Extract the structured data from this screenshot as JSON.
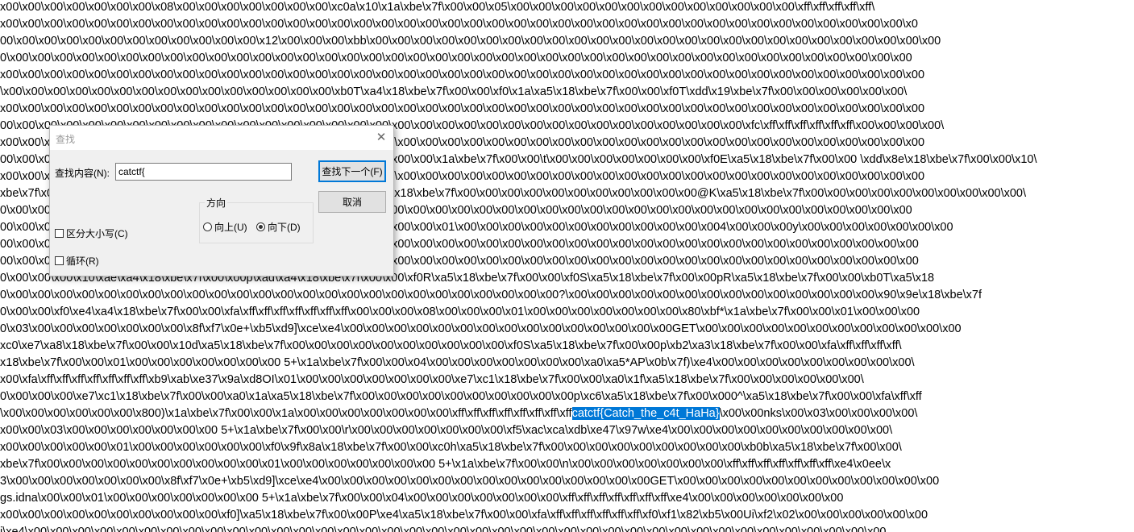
{
  "editor": {
    "lines": [
      {
        "text": "x00\\x00\\x00\\x00\\x00\\x00\\x00\\x08\\x00\\x00\\x00\\x00\\x00\\x00\\x00\\xc0a\\x10\\x1a\\xbe\\x7f\\x00\\x00\\x05\\x00\\x00\\x00\\x00\\x00\\x00\\x00\\x00\\x00\\x00\\x00\\x00\\x00\\xff\\xff\\xff\\xff\\xff\\"
      },
      {
        "text": "x00\\x00\\x00\\x00\\x00\\x00\\x00\\x00\\x00\\x00\\x00\\x00\\x00\\x00\\x00\\x00\\x00\\x00\\x00\\x00\\x00\\x00\\x00\\x00\\x00\\x00\\x00\\x00\\x00\\x00\\x00\\x00\\x00\\x00\\x00\\x00\\x00\\x00\\x00\\x00\\x00\\x0"
      },
      {
        "text": "00\\x00\\x00\\x00\\x00\\x00\\x00\\x00\\x00\\x00\\x00\\x00\\x12\\x00\\x00\\x00\\xbb\\x00\\x00\\x00\\x00\\x00\\x00\\x00\\x00\\x00\\x00\\x00\\x00\\x00\\x00\\x00\\x00\\x00\\x00\\x00\\x00\\x00\\x00\\x00\\x00\\x00\\x00"
      },
      {
        "text": "0\\x00\\x00\\x00\\x00\\x00\\x00\\x00\\x00\\x00\\x00\\x00\\x00\\x00\\x00\\x00\\x00\\x00\\x00\\x00\\x00\\x00\\x00\\x00\\x00\\x00\\x00\\x00\\x00\\x00\\x00\\x00\\x00\\x00\\x00\\x00\\x00\\x00\\x00\\x00\\x00\\x00"
      },
      {
        "text": "x00\\x00\\x00\\x00\\x00\\x00\\x00\\x00\\x00\\x00\\x00\\x00\\x00\\x00\\x00\\x00\\x00\\x00\\x00\\x00\\x00\\x00\\x00\\x00\\x00\\x00\\x00\\x00\\x00\\x00\\x00\\x00\\x00\\x00\\x00\\x00\\x00\\x00\\x00\\x00\\x00\\x00"
      },
      {
        "text": "\\x00\\x00\\x00\\x00\\x00\\x00\\x00\\x00\\x00\\x00\\x00\\x00\\x00\\x00\\x00\\xb0T\\xa4\\x18\\xbe\\x7f\\x00\\x00\\xf0\\x1a\\xa5\\x18\\xbe\\x7f\\x00\\x00\\xf0T\\xdd\\x19\\xbe\\x7f\\x00\\x00\\x00\\x00\\x00\\x00\\"
      },
      {
        "text": "x00\\x00\\x00\\x00\\x00\\x00\\x00\\x00\\x00\\x00\\x00\\x00\\x00\\x00\\x00\\x00\\x00\\x00\\x00\\x00\\x00\\x00\\x00\\x00\\x00\\x00\\x00\\x00\\x00\\x00\\x00\\x00\\x00\\x00\\x00\\x00\\x00\\x00\\x00\\x00\\x00\\x00"
      },
      {
        "text": "00\\x00\\x00\\x00\\x00\\x00\\x00\\x00\\x00\\x00\\x00\\x00\\x00\\x00\\x00\\x00\\x00\\x00\\x00\\x00\\x00\\x00\\x00\\x00\\x00\\x00\\x00\\x00\\x00\\x00\\x00\\x00\\x00\\x00\\xfc\\xff\\xff\\xff\\xff\\xff\\xff\\x00\\x00\\x00\\x00\\"
      },
      {
        "text": "x00\\x00\\x00\\x00\\x00\\x00\\x00\\x00\\x00\\x00\\x00\\x00\\x00\\x00\\x00\\x00\\x00\\x00\\x00\\x00\\x00\\x00\\x00\\x00\\x00\\x00\\x00\\x00\\x00\\x00\\x00\\x00\\x00\\x00\\x00\\x00\\x00\\x00\\x00\\x00\\x00\\x00"
      },
      {
        "text": "00\\x00\\x00\\x00\\x00\\x00\\x00\\x00\\x00\\x00\\x00\\x00\\x00\\x00\\x00\\x00\\x00\\x00\\x00\\x00\\x1a\\xbe\\x7f\\x00\\x00\\t\\x00\\x00\\x00\\x00\\x00\\x00\\x00\\xf0E\\xa5\\x18\\xbe\\x7f\\x00\\x00 \\xdd\\x8e\\x18\\xbe\\x7f\\x00\\x00\\x10\\"
      },
      {
        "text": "x00\\x00\\x00\\x00\\x00\\x00\\x00\\x00\\x00\\x00\\x00\\x00\\x00\\x00\\x00\\x00\\x00\\x00\\x00\\x00\\x00\\x00\\x00\\x00\\x00\\x00\\x00\\x00\\x00\\x00\\x00\\x00\\x00\\x00\\x00\\x00\\x00\\x00\\x00\\x00\\x00\\x00"
      },
      {
        "text": "xbe\\x7f\\x00\\x00\\x00\\x00\\x00\\x00\\x00\\x00\\x00\\x00\\x00\\x00\\x00\\x00\\x00\\x00\\x18\\xbe\\x7f\\x00\\x00\\x00\\x00\\x00\\x00\\x00\\x00\\x00\\x00\\x00@K\\xa5\\x18\\xbe\\x7f\\x00\\x00\\x00\\x00\\x00\\x00\\x00\\x00\\x00\\x00\\"
      },
      {
        "text": "0\\x00\\x00\\x00\\x00\\x00\\x00\\x00\\x00\\x00\\x00\\x00\\x00\\x00\\x00\\x00\\x00\\x00\\x00\\x00\\x00\\x00\\x00\\x00\\x00\\x00\\x00\\x00\\x00\\x00\\x00\\x00\\x00\\x00\\x00\\x00\\x00\\x00\\x00\\x00\\x00\\x00"
      },
      {
        "text": "00\\x00\\x00\\x00\\x00\\x00\\x00\\x00\\x00\\x00\\x00\\x00\\x00\\x00\\x00\\x00\\x00\\x00\\x00\\x00\\x01\\x00\\x00\\x00\\x00\\x00\\x00\\x00\\x00\\x00\\x00\\x00\\x004\\x00\\x00\\x00y\\x00\\x00\\x00\\x00\\x00\\x00\\x00"
      },
      {
        "text": "00\\x00\\x00\\x00\\x00\\x00\\x00\\x00\\x00\\x00\\x00\\x00\\x00\\x00\\x00\\x00\\x00\\x00\\x00\\x00\\x00\\x00\\x00\\x00\\x00\\x00\\x00\\x00\\x00\\x00\\x00\\x00\\x00\\x00\\x00\\x00\\x00\\x00\\x00\\x00\\x00\\x00"
      },
      {
        "text": "00\\x00\\x00\\x00\\x00\\x00\\x00\\x00\\x00\\x00\\x00\\x00\\x00\\x00\\x00\\x00\\x00\\x00\\x00\\x00\\x00\\x00\\x00\\x00\\x00\\x00\\x00\\x00\\x00\\x00\\x00\\x00\\x00\\x00\\x00\\x00\\x00\\x00\\x00\\x00\\x00\\x00"
      },
      {
        "text": "0\\x00\\x00\\x00\\x10\\xae\\xa4\\x18\\xbe\\x7f\\x00\\x00p\\xad\\xa4\\x18\\xbe\\x7f\\x00\\x00\\xf0R\\xa5\\x18\\xbe\\x7f\\x00\\x00\\xf0S\\xa5\\x18\\xbe\\x7f\\x00\\x00pR\\xa5\\x18\\xbe\\x7f\\x00\\x00\\xb0T\\xa5\\x18"
      },
      {
        "text": "0\\x00\\x00\\x00\\x00\\x00\\x00\\x00\\x00\\x00\\x00\\x00\\x00\\x00\\x00\\x00\\x00\\x00\\x00\\x00\\x00\\x00\\x00\\x00\\x00\\x00?\\x00\\x00\\x00\\x00\\x00\\x00\\x00\\x00\\x00\\x00\\x00\\x00\\x00\\x00\\x90\\x9e\\x18\\xbe\\x7f"
      },
      {
        "text": "0\\x00\\x00\\xf0\\xe4\\xa4\\x18\\xbe\\x7f\\x00\\x00\\xfa\\xff\\xff\\xff\\xff\\xff\\xff\\xff\\x00\\x00\\x00\\x08\\x00\\x00\\x00\\x01\\x00\\x00\\x00\\x00\\x00\\x00\\x00\\x80\\xbf*\\x1a\\xbe\\x7f\\x00\\x00\\x01\\x00\\x00\\x00"
      },
      {
        "text": "0\\x03\\x00\\x00\\x00\\x00\\x00\\x00\\x00\\x8f\\xf7\\x0e+\\xb5\\xd9]\\xce\\xe4\\x00\\x00\\x00\\x00\\x00\\x00\\x00\\x00\\x00\\x00\\x00\\x00\\x00\\x00\\x00GET\\x00\\x00\\x00\\x00\\x00\\x00\\x00\\x00\\x00\\x00\\x00\\x00"
      },
      {
        "text": "xc0\\xe7\\xa8\\x18\\xbe\\x7f\\x00\\x00\\x10d\\xa5\\x18\\xbe\\x7f\\x00\\x00\\x00\\x00\\x00\\x00\\x00\\x00\\x00\\x00\\xf0S\\xa5\\x18\\xbe\\x7f\\x00\\x00p\\xb2\\xa3\\x18\\xbe\\x7f\\x00\\x00\\xfa\\xff\\xff\\xff\\xff\\"
      },
      {
        "text": "x18\\xbe\\x7f\\x00\\x00\\x01\\x00\\x00\\x00\\x00\\x00\\x00\\x00 5+\\x1a\\xbe\\x7f\\x00\\x00\\x04\\x00\\x00\\x00\\x00\\x00\\x00\\x00\\xa0\\xa5*AP\\x0b\\x7f)\\xe4\\x00\\x00\\x00\\x00\\x00\\x00\\x00\\x00\\x00\\"
      },
      {
        "text": "x00\\xfa\\xff\\xff\\xff\\xff\\xff\\xff\\xff\\xb9\\xab\\xe37\\x9a\\xd8OI\\x01\\x00\\x00\\x00\\x00\\x00\\x00\\x00\\xe7\\xc1\\x18\\xbe\\x7f\\x00\\x00\\xa0\\x1f\\xa5\\x18\\xbe\\x7f\\x00\\x00\\x00\\x00\\x00\\x00\\"
      },
      {
        "text": "0\\x00\\x00\\x00\\xe7\\xc1\\x18\\xbe\\x7f\\x00\\x00\\xa0\\x1a\\xa5\\x18\\xbe\\x7f\\x00\\x00\\x00\\x00\\x00\\x00\\x00\\x00\\x00\\x00p\\xc6\\xa5\\x18\\xbe\\x7f\\x00\\x000^\\xa5\\x18\\xbe\\x7f\\x00\\x00\\xfa\\xff\\xff"
      },
      {
        "text": "\\x00\\x00\\x00\\x00\\x00\\x00\\x800)\\x1a\\xbe\\x7f\\x00\\x00\\x1a\\x00\\x00\\x00\\x00\\x00\\x00\\x00\\xff\\xff\\xff\\xff\\xff\\xff\\xff\\xff",
        "sel": "catctf{Catch_the_c4t_HaHa}",
        "after": "\\x00\\x00nks\\x00\\x03\\x00\\x00\\x00\\x00\\"
      },
      {
        "text": "x00\\x00\\x03\\x00\\x00\\x00\\x00\\x00\\x00\\x00 5+\\x1a\\xbe\\x7f\\x00\\x00\\r\\x00\\x00\\x00\\x00\\x00\\x00\\x00\\xf5\\xac\\xca\\xdb\\xe47\\x97w\\xe4\\x00\\x00\\x00\\x00\\x00\\x00\\x00\\x00\\x00\\x00\\"
      },
      {
        "text": "x00\\x00\\x00\\x00\\x00\\x01\\x00\\x00\\x00\\x00\\x00\\x00\\xf0\\x9f\\x8a\\x18\\xbe\\x7f\\x00\\x00\\xc0h\\xa5\\x18\\xbe\\x7f\\x00\\x00\\x00\\x00\\x00\\x00\\x00\\x00\\x00\\xb0b\\xa5\\x18\\xbe\\x7f\\x00\\x00\\"
      },
      {
        "text": "xbe\\x7f\\x00\\x00\\x00\\x00\\x00\\x00\\x00\\x00\\x00\\x00\\x01\\x00\\x00\\x00\\x00\\x00\\x00\\x00 5+\\x1a\\xbe\\x7f\\x00\\x00\\n\\x00\\x00\\x00\\x00\\x00\\x00\\x00\\xff\\xff\\xff\\xff\\xff\\xff\\xff\\xe4\\x0ee\\x"
      },
      {
        "text": "3\\x00\\x00\\x00\\x00\\x00\\x00\\x00\\x8f\\xf7\\x0e+\\xb5\\xd9]\\xce\\xe4\\x00\\x00\\x00\\x00\\x00\\x00\\x00\\x00\\x00\\x00\\x00\\x00\\x00\\x00\\x00GET\\x00\\x00\\x00\\x00\\x00\\x00\\x00\\x00\\x00\\x00\\x00\\x00"
      },
      {
        "text": "gs.idna\\x00\\x00\\x01\\x00\\x00\\x00\\x00\\x00\\x00\\x00 5+\\x1a\\xbe\\x7f\\x00\\x00\\x04\\x00\\x00\\x00\\x00\\x00\\x00\\x00\\xff\\xff\\xff\\xff\\xff\\xff\\xff\\xe4\\x00\\x00\\x00\\x00\\x00\\x00\\x00"
      },
      {
        "text": "x00\\x00\\x00\\x00\\x00\\x00\\x00\\x00\\x00\\x00\\xf0]\\xa5\\x18\\xbe\\x7f\\x00\\x00P\\xe4\\xa5\\x18\\xbe\\x7f\\x00\\x00\\xfa\\xff\\xff\\xff\\xff\\xff\\xff\\xf0\\xf1\\x82\\xb5\\x00Ui\\xf2\\x02\\x00\\x00\\x00\\x00\\x00\\x00"
      },
      {
        "text": "i\\xe4\\x00\\x00\\x00\\x00\\x00\\x00\\x00\\x00\\x00\\x00\\x00\\x00\\x00\\x00\\x00\\x00\\x00\\x00\\x00\\x00\\x00\\x00\\x00\\x00\\x00\\x00\\x00\\x00\\x00\\x00\\x00\\x00\\x00\\x00\\x00\\x00\\x00\\x00\\x00"
      }
    ]
  },
  "find_dialog": {
    "title": "查找",
    "find_label": "查找内容(N):",
    "find_value": "catctf{",
    "find_next_label": "查找下一个(F)",
    "cancel_label": "取消",
    "direction_label": "方向",
    "up_label": "向上(U)",
    "down_label": "向下(D)",
    "match_case_label": "区分大小写(C)",
    "wrap_label": "循环(R)"
  }
}
